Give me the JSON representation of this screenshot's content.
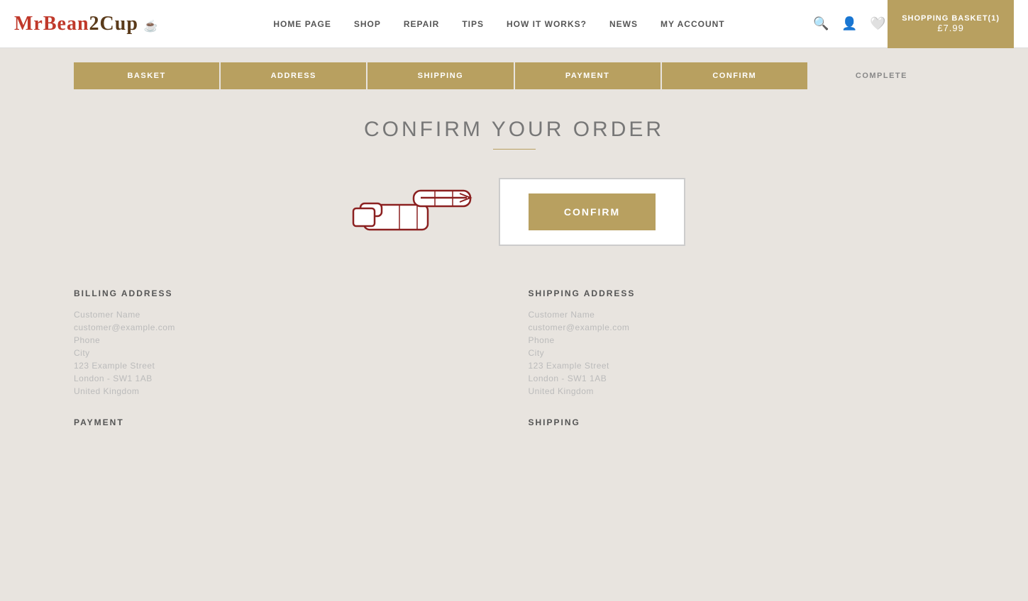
{
  "site": {
    "logo": "MrBean2Cup"
  },
  "nav": {
    "items": [
      {
        "label": "HOME PAGE",
        "id": "home"
      },
      {
        "label": "SHOP",
        "id": "shop"
      },
      {
        "label": "REPAIR",
        "id": "repair"
      },
      {
        "label": "TIPS",
        "id": "tips"
      },
      {
        "label": "HOW IT WORKS?",
        "id": "how-it-works"
      },
      {
        "label": "NEWS",
        "id": "news"
      },
      {
        "label": "MY ACCOUNT",
        "id": "my-account"
      }
    ]
  },
  "cart": {
    "label": "SHOPPING BASKET(1)",
    "price": "£7.99"
  },
  "progress": {
    "steps": [
      {
        "label": "BASKET",
        "active": true
      },
      {
        "label": "ADDRESS",
        "active": true
      },
      {
        "label": "SHIPPING",
        "active": true
      },
      {
        "label": "PAYMENT",
        "active": true
      },
      {
        "label": "CONFIRM",
        "active": true
      },
      {
        "label": "COMPLETE",
        "active": false
      }
    ]
  },
  "page": {
    "title": "CONFIRM YOUR ORDER",
    "confirm_button": "CONFIRM"
  },
  "billing": {
    "heading": "BILLING ADDRESS",
    "lines": [
      "Customer Name",
      "customer@example.com",
      "Phone",
      "City",
      "123 Example Street",
      "London - SW1 1AB",
      "United Kingdom"
    ]
  },
  "shipping": {
    "heading": "SHIPPING ADDRESS",
    "lines": [
      "Customer Name",
      "customer@example.com",
      "Phone",
      "City",
      "123 Example Street",
      "London - SW1 1AB",
      "United Kingdom"
    ]
  },
  "payment_heading": "PAYMENT",
  "shipping_heading": "SHIPPING"
}
